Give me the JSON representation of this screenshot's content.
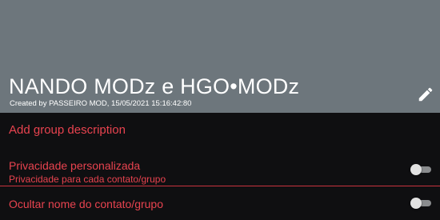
{
  "group": {
    "title": "NANDO MODz e HGO•MODz",
    "created_by": "Created by PASSEIRO MOD, 15/05/2021 15:16:42:80"
  },
  "icons": {
    "edit": "pencil-icon"
  },
  "description": {
    "add_label": "Add group description"
  },
  "settings": [
    {
      "title": "Privacidade personalizada",
      "subtitle": "Privacidade para cada contato/grupo",
      "enabled": false
    },
    {
      "title": "Ocultar nome do contato/grupo",
      "enabled": false
    }
  ],
  "colors": {
    "header_bg": "#6d767c",
    "body_bg": "#0f0f11",
    "accent": "#e8434f",
    "divider": "#c8323d",
    "toggle_off_track": "#8a8c8e",
    "toggle_off_thumb": "#e2e2e2"
  }
}
